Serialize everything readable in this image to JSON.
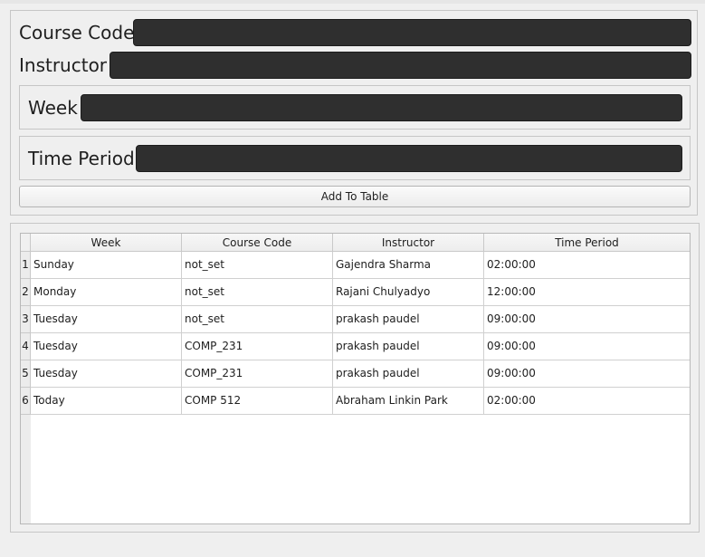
{
  "form": {
    "course_code_label": "Course Code",
    "course_code_value": "",
    "instructor_label": "Instructor",
    "instructor_value": "",
    "week_label": "Week",
    "week_value": "",
    "time_period_label": "Time Period",
    "time_period_value": "",
    "add_button_label": "Add To Table"
  },
  "table": {
    "columns": [
      "Week",
      "Course Code",
      "Instructor",
      "Time Period"
    ],
    "rows": [
      {
        "num": "1",
        "week": "Sunday",
        "course_code": "not_set",
        "instructor": "Gajendra Sharma",
        "time_period": "02:00:00"
      },
      {
        "num": "2",
        "week": "Monday",
        "course_code": "not_set",
        "instructor": "Rajani Chulyadyo",
        "time_period": "12:00:00"
      },
      {
        "num": "3",
        "week": "Tuesday",
        "course_code": "not_set",
        "instructor": "prakash paudel",
        "time_period": "09:00:00"
      },
      {
        "num": "4",
        "week": "Tuesday",
        "course_code": "COMP_231",
        "instructor": "prakash paudel",
        "time_period": "09:00:00"
      },
      {
        "num": "5",
        "week": "Tuesday",
        "course_code": "COMP_231",
        "instructor": "prakash paudel",
        "time_period": "09:00:00"
      },
      {
        "num": "6",
        "week": "Today",
        "course_code": "COMP 512",
        "instructor": "Abraham Linkin Park",
        "time_period": "02:00:00"
      }
    ]
  }
}
